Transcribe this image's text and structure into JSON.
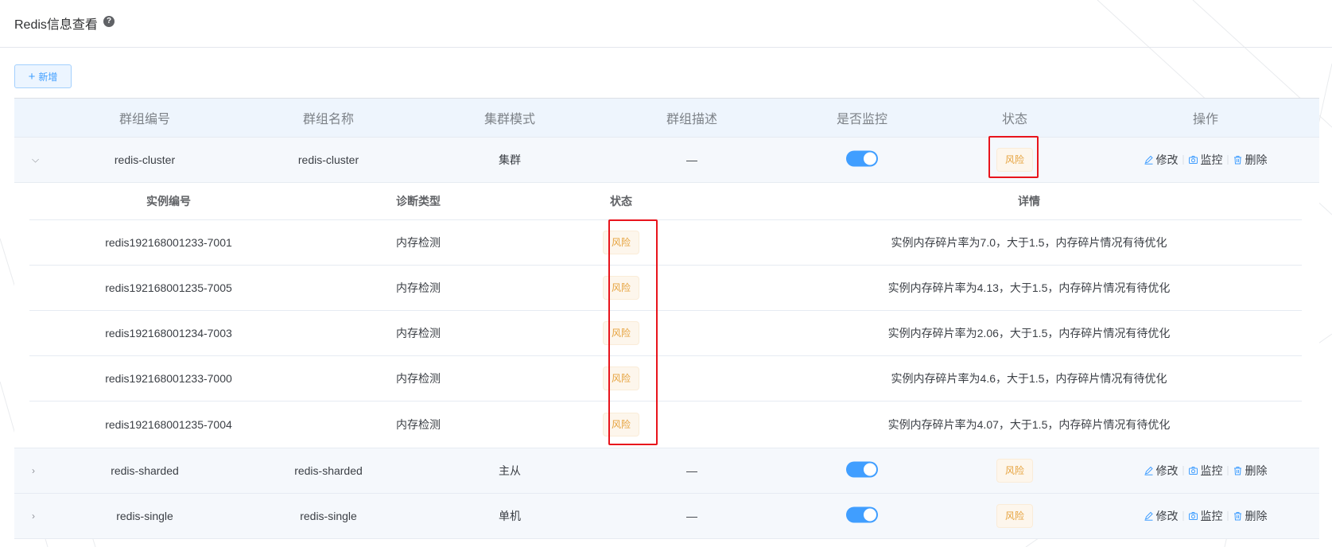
{
  "header": {
    "title": "Redis信息查看",
    "help_icon": "question-circle-icon"
  },
  "toolbar": {
    "add_label": "新增",
    "add_icon": "plus-icon"
  },
  "table": {
    "columns": [
      "群组编号",
      "群组名称",
      "集群模式",
      "群组描述",
      "是否监控",
      "状态",
      "操作"
    ],
    "rows": [
      {
        "id": "redis-cluster",
        "name": "redis-cluster",
        "mode": "集群",
        "desc": "—",
        "monitored": true,
        "status": "风险",
        "expanded": true
      },
      {
        "id": "redis-sharded",
        "name": "redis-sharded",
        "mode": "主从",
        "desc": "—",
        "monitored": true,
        "status": "风险",
        "expanded": false
      },
      {
        "id": "redis-single",
        "name": "redis-single",
        "mode": "单机",
        "desc": "—",
        "monitored": true,
        "status": "风险",
        "expanded": false
      }
    ],
    "actions": {
      "edit": "修改",
      "monitor": "监控",
      "delete": "删除"
    }
  },
  "detail": {
    "columns": [
      "实例编号",
      "诊断类型",
      "状态",
      "详情"
    ],
    "rows": [
      {
        "instance": "redis192168001233-7001",
        "type": "内存检测",
        "status": "风险",
        "detail": "实例内存碎片率为7.0，大于1.5，内存碎片情况有待优化"
      },
      {
        "instance": "redis192168001235-7005",
        "type": "内存检测",
        "status": "风险",
        "detail": "实例内存碎片率为4.13，大于1.5，内存碎片情况有待优化"
      },
      {
        "instance": "redis192168001234-7003",
        "type": "内存检测",
        "status": "风险",
        "detail": "实例内存碎片率为2.06，大于1.5，内存碎片情况有待优化"
      },
      {
        "instance": "redis192168001233-7000",
        "type": "内存检测",
        "status": "风险",
        "detail": "实例内存碎片率为4.6，大于1.5，内存碎片情况有待优化"
      },
      {
        "instance": "redis192168001235-7004",
        "type": "内存检测",
        "status": "风险",
        "detail": "实例内存碎片率为4.07，大于1.5，内存碎片情况有待优化"
      }
    ]
  },
  "colors": {
    "accent": "#409eff",
    "warning": "#e6a23c",
    "highlight": "#e8141c"
  }
}
